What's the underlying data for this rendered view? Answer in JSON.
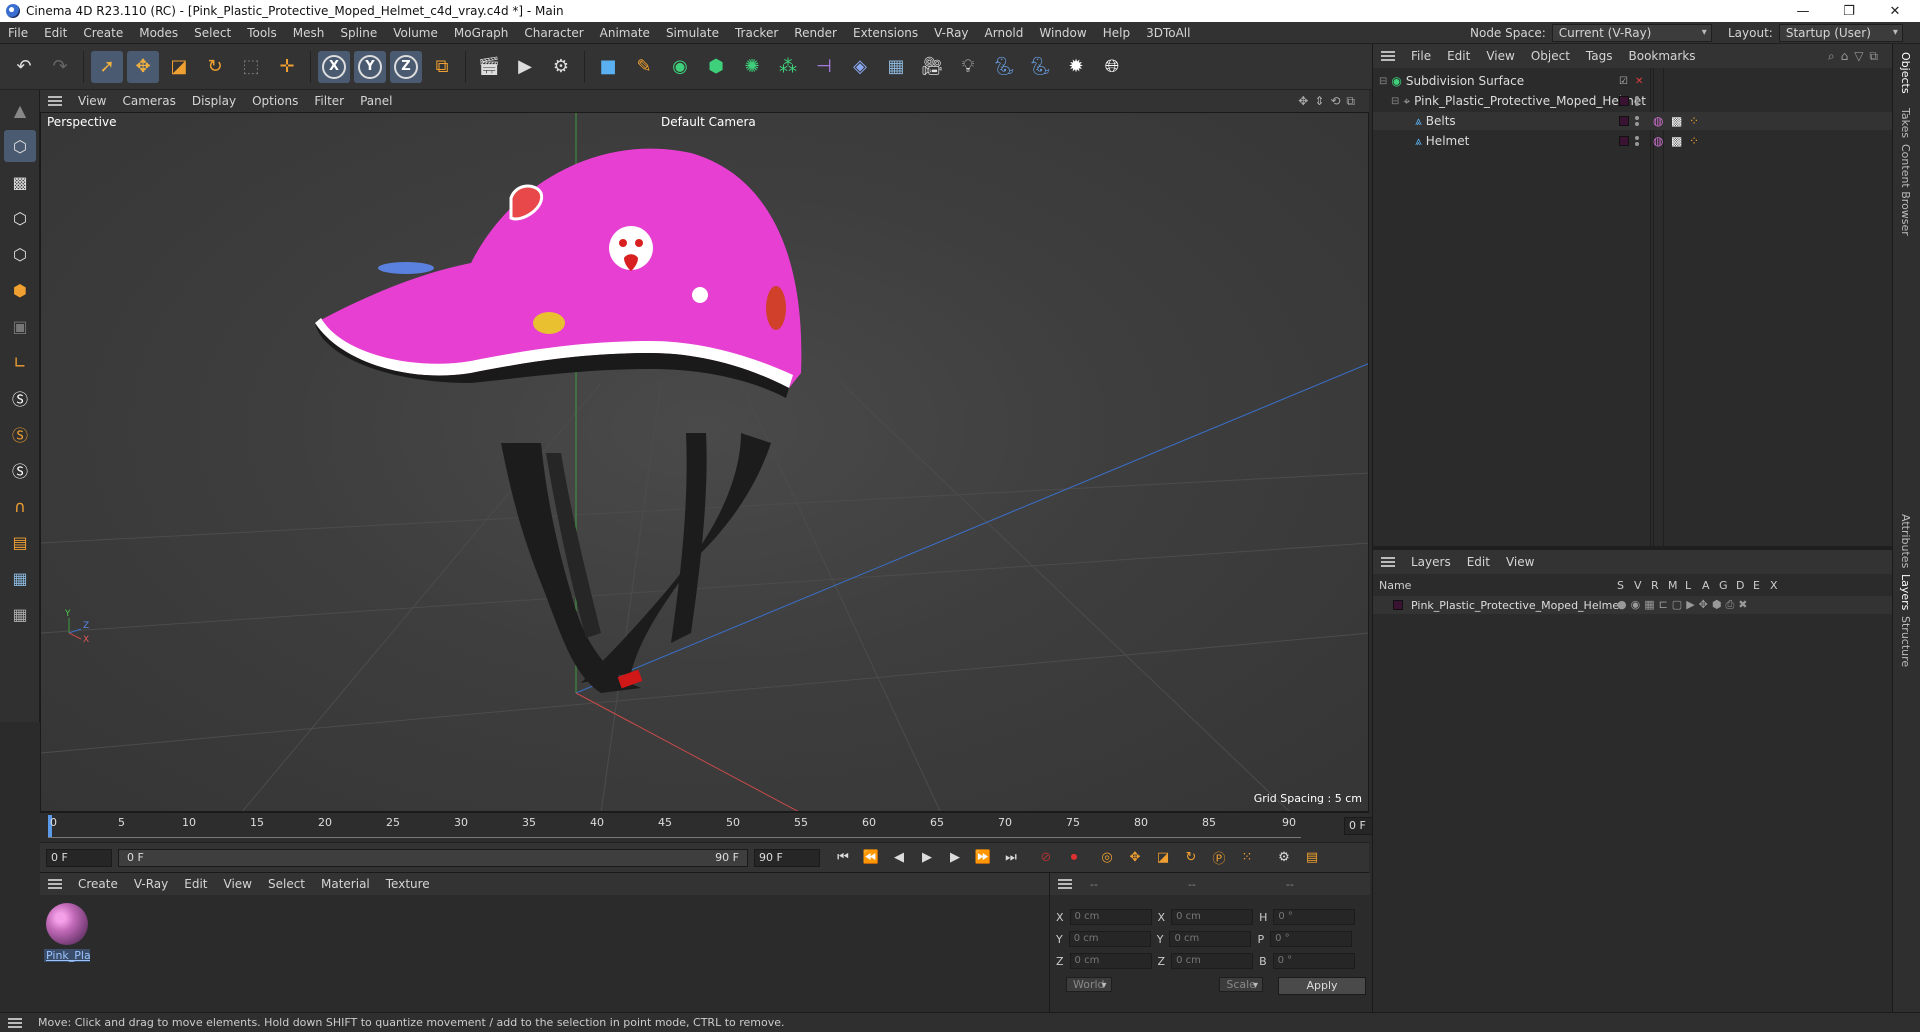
{
  "window": {
    "title": "Cinema 4D R23.110 (RC) - [Pink_Plastic_Protective_Moped_Helmet_c4d_vray.c4d *] - Main",
    "minimize": "—",
    "maximize": "❐",
    "close": "✕"
  },
  "menubar": {
    "items": [
      "File",
      "Edit",
      "Create",
      "Modes",
      "Select",
      "Tools",
      "Mesh",
      "Spline",
      "Volume",
      "MoGraph",
      "Character",
      "Animate",
      "Simulate",
      "Tracker",
      "Render",
      "Extensions",
      "V-Ray",
      "Arnold",
      "Window",
      "Help",
      "3DToAll"
    ],
    "node_space_label": "Node Space:",
    "node_space_value": "Current (V-Ray)",
    "layout_label": "Layout:",
    "layout_value": "Startup (User)"
  },
  "viewport": {
    "menu": [
      "View",
      "Cameras",
      "Display",
      "Options",
      "Filter",
      "Panel"
    ],
    "projection": "Perspective",
    "camera": "Default Camera",
    "grid_spacing": "Grid Spacing : 5 cm",
    "axis": {
      "y": "Y",
      "z": "Z",
      "x": "X"
    }
  },
  "timeline": {
    "labels": [
      "0",
      "5",
      "10",
      "15",
      "20",
      "25",
      "30",
      "35",
      "40",
      "45",
      "50",
      "55",
      "60",
      "65",
      "70",
      "75",
      "80",
      "85",
      "90"
    ],
    "current_frame": "0 F"
  },
  "transport": {
    "start": "0 F",
    "range_start": "0 F",
    "range_end": "90 F",
    "end": "90 F"
  },
  "material_panel": {
    "menu": [
      "Create",
      "V-Ray",
      "Edit",
      "View",
      "Select",
      "Material",
      "Texture"
    ],
    "material_name": "Pink_Plas"
  },
  "coordinates": {
    "headers": [
      "--",
      "--",
      "--"
    ],
    "rows": [
      {
        "l1": "X",
        "v1": "0 cm",
        "l2": "X",
        "v2": "0 cm",
        "l3": "H",
        "v3": "0 °"
      },
      {
        "l1": "Y",
        "v1": "0 cm",
        "l2": "Y",
        "v2": "0 cm",
        "l3": "P",
        "v3": "0 °"
      },
      {
        "l1": "Z",
        "v1": "0 cm",
        "l2": "Z",
        "v2": "0 cm",
        "l3": "B",
        "v3": "0 °"
      }
    ],
    "coord_mode": "World",
    "scale_mode": "Scale",
    "apply": "Apply"
  },
  "objects_panel": {
    "menu": [
      "File",
      "Edit",
      "View",
      "Object",
      "Tags",
      "Bookmarks"
    ],
    "items": [
      {
        "name": "Subdivision Surface"
      },
      {
        "name": "Pink_Plastic_Protective_Moped_Helmet"
      },
      {
        "name": "Belts"
      },
      {
        "name": "Helmet"
      }
    ]
  },
  "layers_panel": {
    "menu": [
      "Layers",
      "Edit",
      "View"
    ],
    "name_header": "Name",
    "flag_headers": [
      "S",
      "V",
      "R",
      "M",
      "L",
      "A",
      "G",
      "D",
      "E",
      "X"
    ],
    "layer_name": "Pink_Plastic_Protective_Moped_Helmet"
  },
  "side_tabs": [
    "Objects",
    "Takes",
    "Content Browser",
    "Attributes",
    "Layers",
    "Structure"
  ],
  "status": "Move: Click and drag to move elements. Hold down SHIFT to quantize movement / add to the selection in point mode, CTRL to remove.",
  "colors": {
    "helmet": "#e83fd3",
    "selection": "#4a5a70",
    "axis_x": "#c84a4a",
    "axis_y": "#4ac84a",
    "axis_z": "#4a7ad8"
  }
}
